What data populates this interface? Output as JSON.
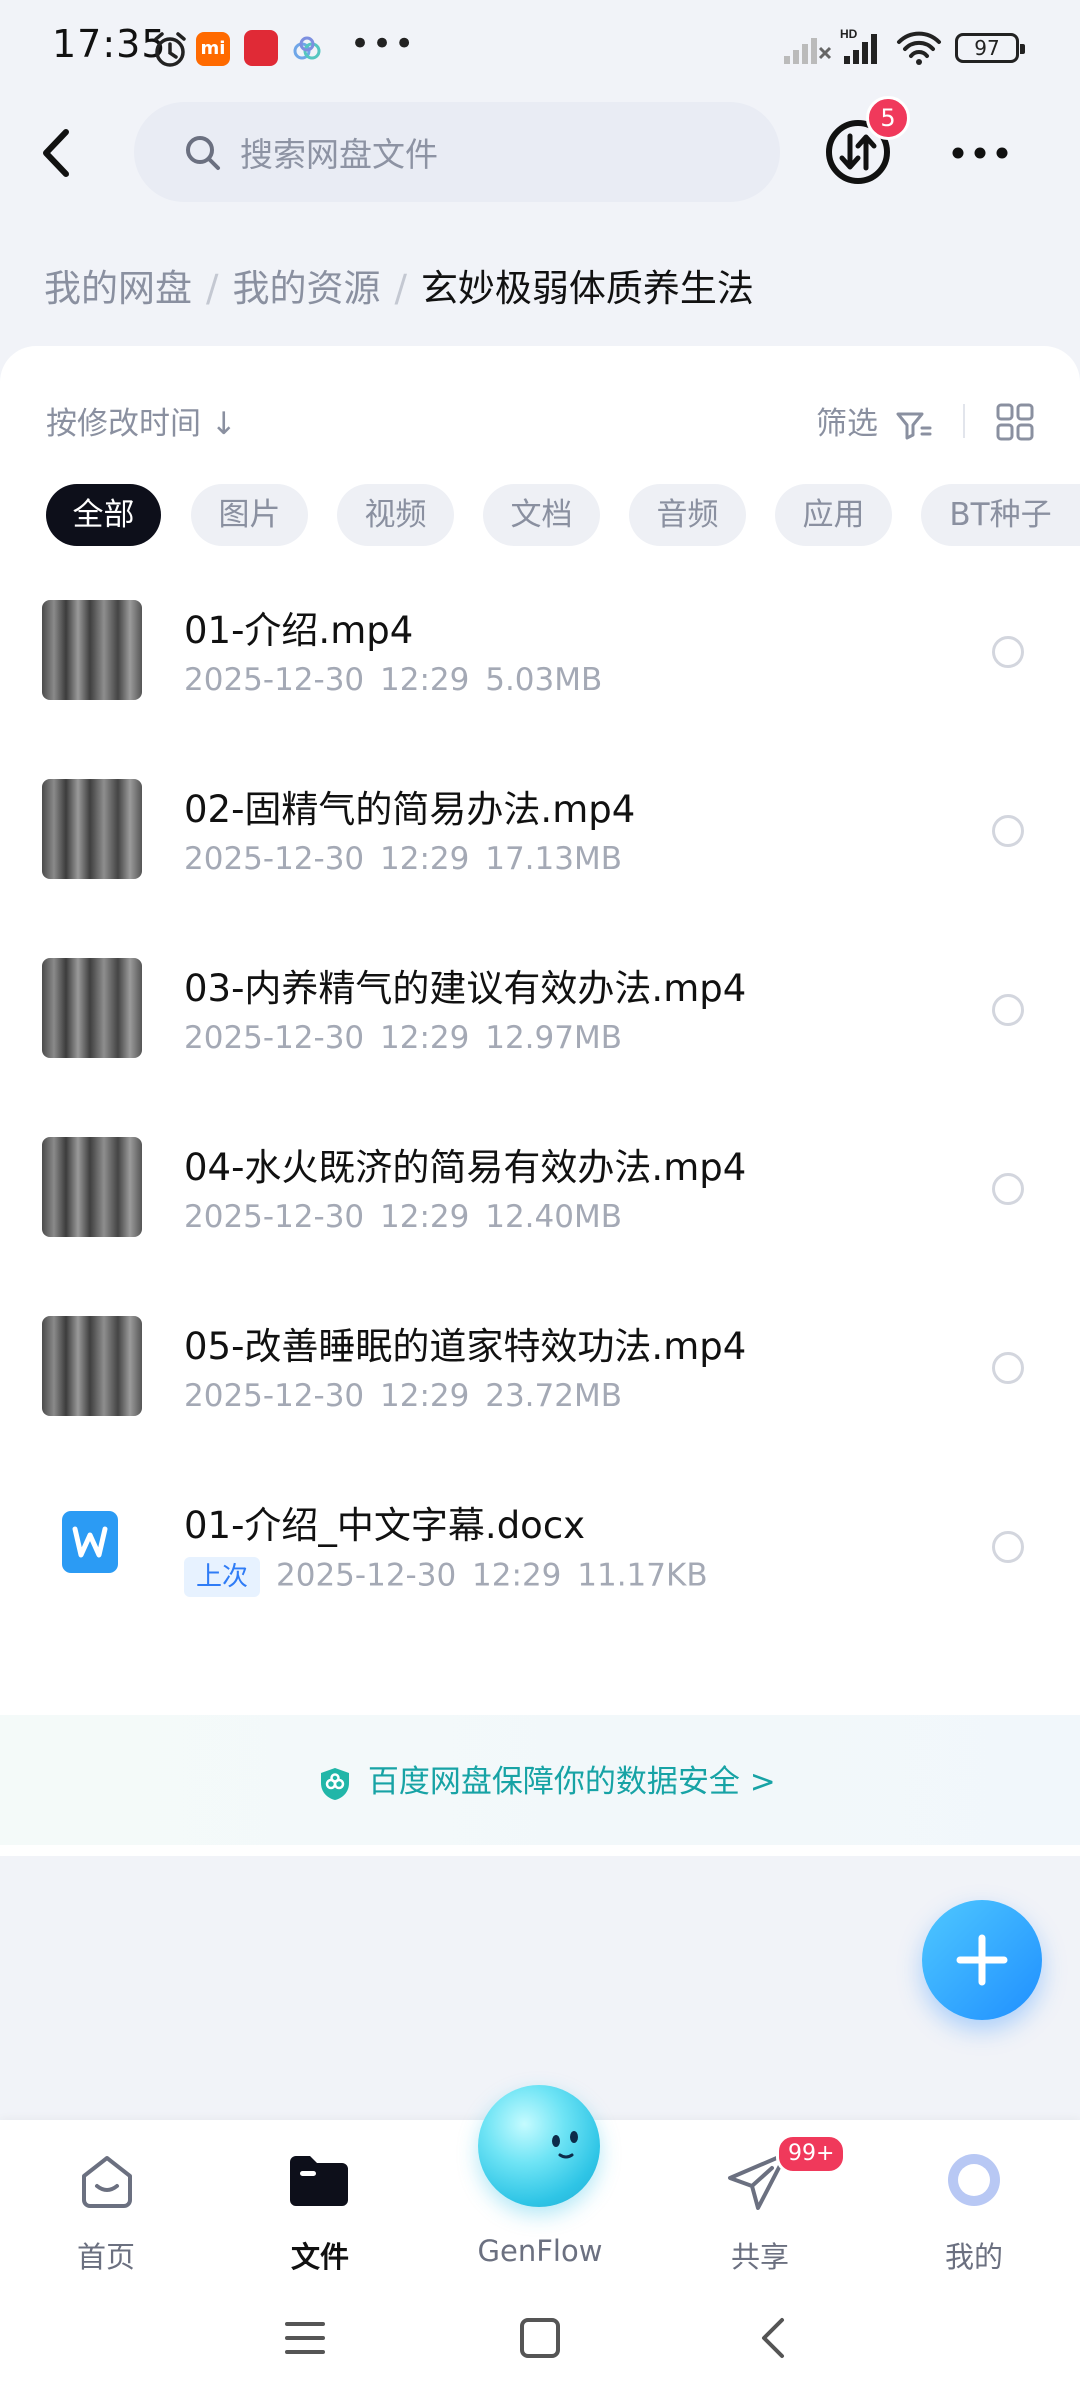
{
  "status_bar": {
    "time": "17:35",
    "battery": "97"
  },
  "header": {
    "search_placeholder": "搜索网盘文件",
    "transfer_badge": "5"
  },
  "breadcrumb": {
    "items": [
      "我的网盘",
      "我的资源"
    ],
    "current": "玄妙极弱体质养生法"
  },
  "toolbar": {
    "sort_label": "按修改时间 ↓",
    "filter_label": "筛选"
  },
  "categories": [
    "全部",
    "图片",
    "视频",
    "文档",
    "音频",
    "应用",
    "BT种子"
  ],
  "files": [
    {
      "name": "01-介绍.mp4",
      "date": "2025-12-30",
      "time": "12:29",
      "size": "5.03MB"
    },
    {
      "name": "02-固精气的简易办法.mp4",
      "date": "2025-12-30",
      "time": "12:29",
      "size": "17.13MB"
    },
    {
      "name": "03-内养精气的建议有效办法.mp4",
      "date": "2025-12-30",
      "time": "12:29",
      "size": "12.97MB"
    },
    {
      "name": "04-水火既济的简易有效办法.mp4",
      "date": "2025-12-30",
      "time": "12:29",
      "size": "12.40MB"
    },
    {
      "name": "05-改善睡眠的道家特效功法.mp4",
      "date": "2025-12-30",
      "time": "12:29",
      "size": "23.72MB"
    },
    {
      "name": "01-介绍_中文字幕.docx",
      "tag": "上次",
      "date": "2025-12-30",
      "time": "12:29",
      "size": "11.17KB"
    }
  ],
  "security_banner": "百度网盘保障你的数据安全 >",
  "bottom_nav": {
    "items": [
      "首页",
      "文件",
      "GenFlow",
      "共享",
      "我的"
    ],
    "share_badge": "99+"
  },
  "colors": {
    "accent": "#1f8fff",
    "badge": "#f0395b",
    "secure": "#17a3a5"
  }
}
